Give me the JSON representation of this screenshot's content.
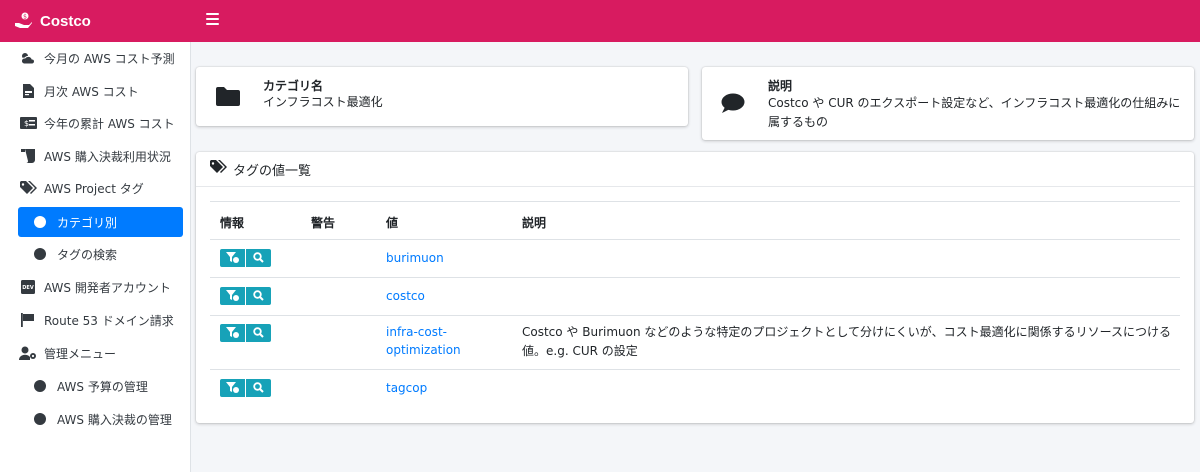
{
  "brand": {
    "title": "Costco"
  },
  "sidebar": {
    "items": [
      {
        "label": "今月の AWS コスト予測",
        "icon": "cloud-sun-icon"
      },
      {
        "label": "月次 AWS コスト",
        "icon": "file-invoice-icon"
      },
      {
        "label": "今年の累計 AWS コスト",
        "icon": "money-check-icon"
      },
      {
        "label": "AWS 購入決裁利用状況",
        "icon": "receipt-icon"
      },
      {
        "label": "AWS Project タグ",
        "icon": "tags-icon"
      },
      {
        "label": "カテゴリ別",
        "icon": "circle-icon",
        "active": true
      },
      {
        "label": "タグの検索",
        "icon": "circle-icon"
      },
      {
        "label": "AWS 開発者アカウント",
        "icon": "dev-icon"
      },
      {
        "label": "Route 53 ドメイン請求",
        "icon": "flag-icon"
      },
      {
        "label": "管理メニュー",
        "icon": "user-cog-icon"
      },
      {
        "label": "AWS 予算の管理",
        "icon": "circle-icon"
      },
      {
        "label": "AWS 購入決裁の管理",
        "icon": "circle-icon"
      }
    ]
  },
  "category_card": {
    "label": "カテゴリ名",
    "value": "インフラコスト最適化",
    "icon": "folder-icon"
  },
  "description_card": {
    "label": "説明",
    "value": "Costco や CUR のエクスポート設定など、インフラコスト最適化の仕組みに属するもの",
    "icon": "comment-icon"
  },
  "tags_card": {
    "title": "タグの値一覧",
    "icon": "tags-icon",
    "columns": {
      "info": "情報",
      "warning": "警告",
      "value": "値",
      "description": "説明"
    },
    "rows": [
      {
        "value": "burimuon",
        "description": ""
      },
      {
        "value": "costco",
        "description": ""
      },
      {
        "value": "infra-cost-optimization",
        "description": "Costco や Burimuon などのような特定のプロジェクトとして分けにくいが、コスト最適化に関係するリソースにつける値。e.g. CUR の設定"
      },
      {
        "value": "tagcop",
        "description": ""
      }
    ]
  },
  "colors": {
    "brand": "#d81b60",
    "active": "#007bff",
    "info_button": "#17a2b8",
    "link": "#007bff"
  }
}
